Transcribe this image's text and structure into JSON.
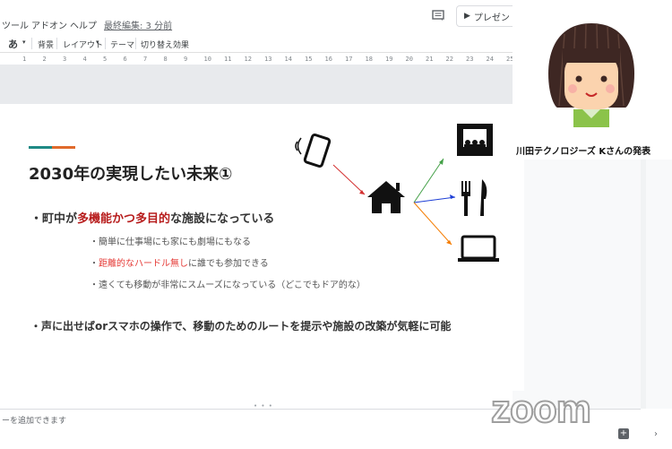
{
  "menu": {
    "items": [
      "ツール",
      "アドオン",
      "ヘルプ"
    ],
    "last_edit": "最終編集: 3 分前"
  },
  "present_button": "プレゼン",
  "toolbar": {
    "input_mode": "あ",
    "background": "背景",
    "layout": "レイアウト",
    "theme": "テーマ",
    "transition": "切り替え効果"
  },
  "ruler": {
    "ticks": [
      "1",
      "2",
      "3",
      "4",
      "5",
      "6",
      "7",
      "8",
      "9",
      "10",
      "11",
      "12",
      "13",
      "14",
      "15",
      "16",
      "17",
      "18",
      "19",
      "20",
      "21",
      "22",
      "23",
      "24",
      "25"
    ]
  },
  "slide": {
    "title": "2030年の実現したい未来①",
    "bullet1": {
      "prefix": "・町中が",
      "highlight": "多機能かつ多目的",
      "suffix": "な施設になっている"
    },
    "sub1": "・簡単に仕事場にも家にも劇場にもなる",
    "sub2": {
      "highlight": "距離的なハードル無し",
      "suffix": "に誰でも参加できる",
      "prefix": "・"
    },
    "sub3": "・遠くても移動が非常にスムーズになっている（どこでもドア的な）",
    "bullet2": "・声に出せばorスマホの操作で、移動のためのルートを提示や施設の改築が気軽に可能",
    "accent_colors": {
      "teal": "#1f8a85",
      "orange": "#e06a2c",
      "red": "#b71c1c"
    }
  },
  "speaker": {
    "name": "川田テクノロジーズ Kさんの発表"
  },
  "notes": {
    "placeholder": "ーを追加できます"
  },
  "watermark": "zoom",
  "icons": [
    "phone-icon",
    "house-icon",
    "theater-icon",
    "restaurant-icon",
    "laptop-icon"
  ]
}
